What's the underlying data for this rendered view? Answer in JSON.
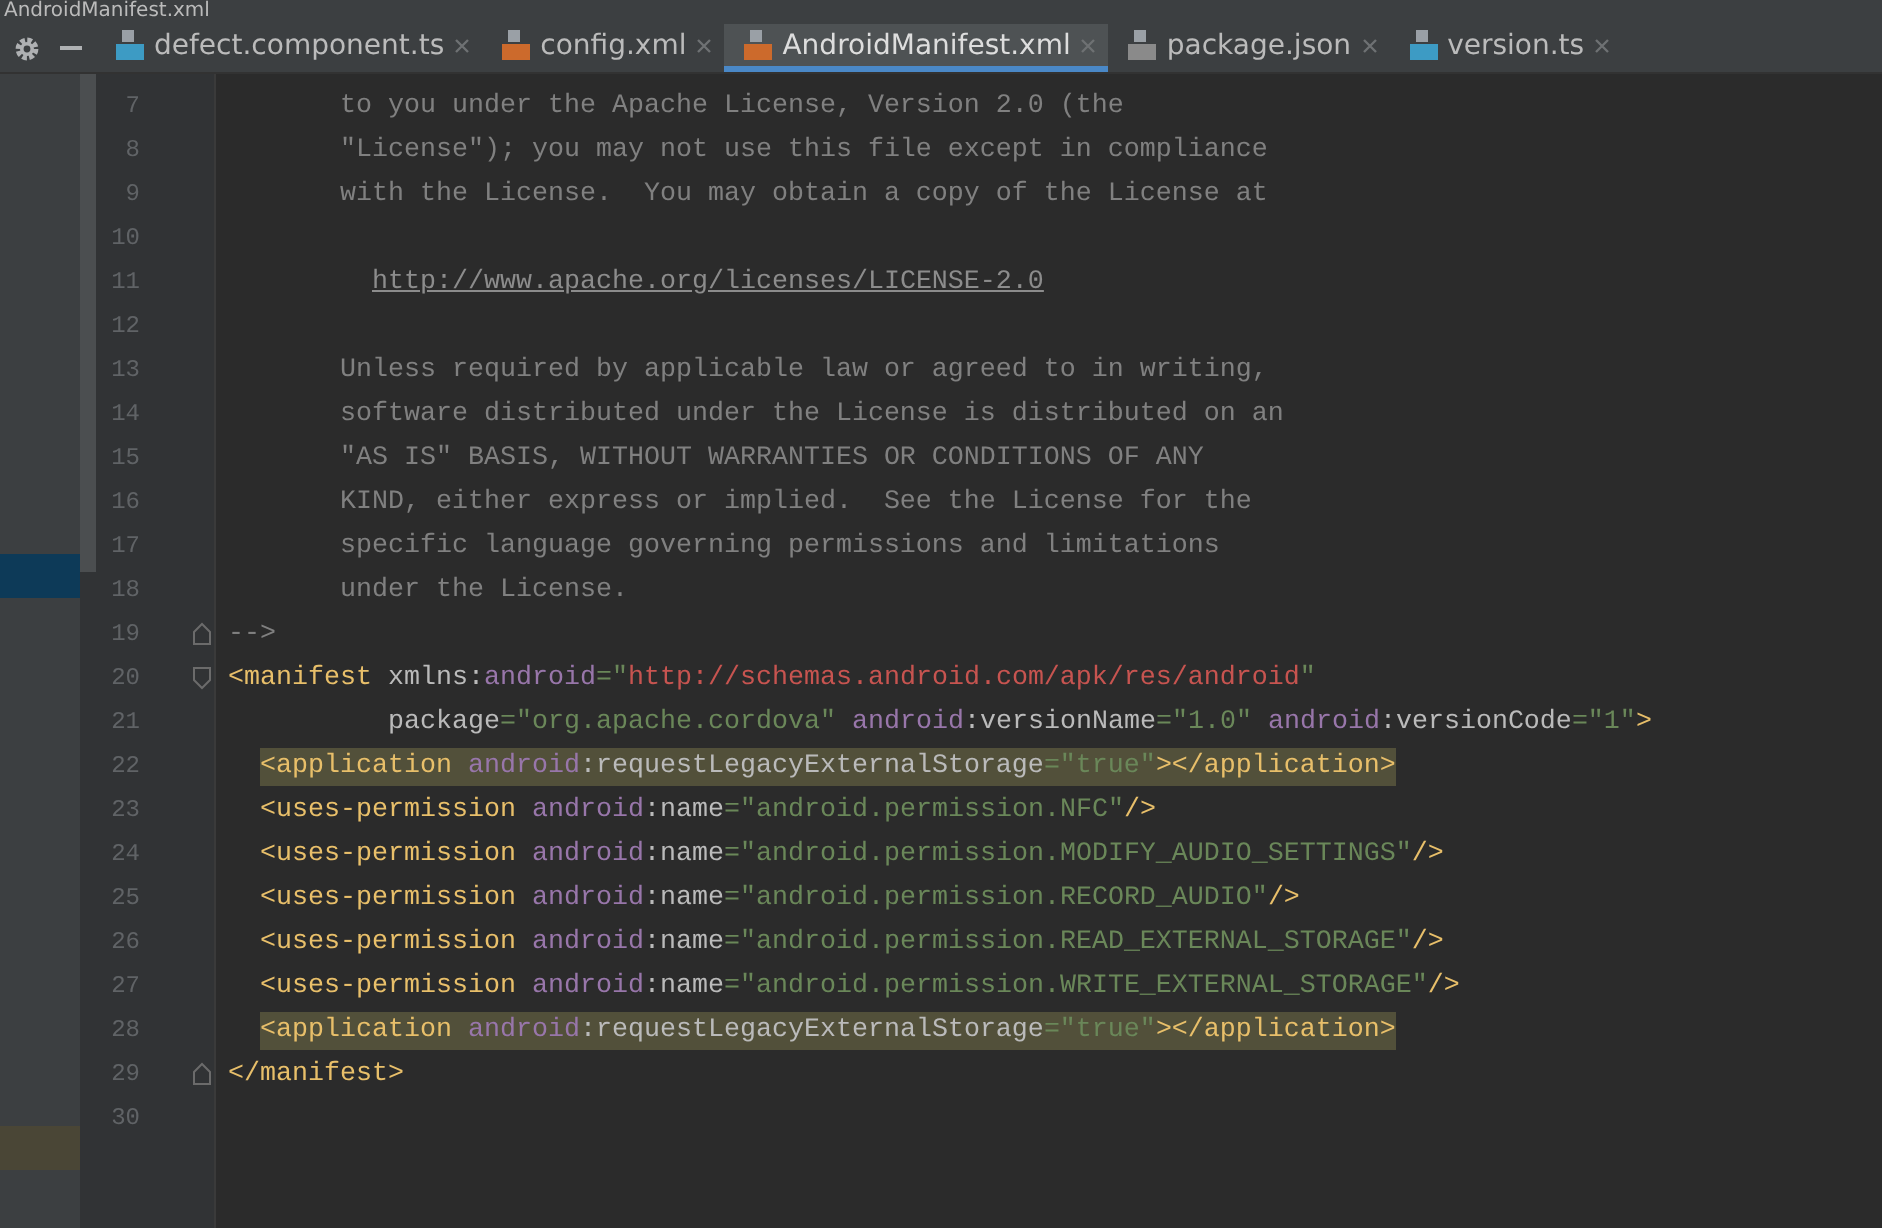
{
  "window": {
    "title": "AndroidManifest.xml"
  },
  "tabs": [
    {
      "label": "defect.component.ts",
      "kind": "ts",
      "selected": false
    },
    {
      "label": "config.xml",
      "kind": "xml",
      "selected": false
    },
    {
      "label": "AndroidManifest.xml",
      "kind": "xml",
      "selected": true
    },
    {
      "label": "package.json",
      "kind": "json",
      "selected": false
    },
    {
      "label": "version.ts",
      "kind": "ts",
      "selected": false
    }
  ],
  "sidebar": {
    "items": [
      {
        "selected": true,
        "kind": "plain"
      },
      {
        "selected": true,
        "kind": "match"
      }
    ]
  },
  "editor": {
    "lines": [
      {
        "number": "7",
        "kind": "comment",
        "highlighted": false,
        "tokens": [
          {
            "kind": "comment",
            "text": "to you under the Apache License, Version 2.0 (the"
          }
        ]
      },
      {
        "number": "8",
        "kind": "comment",
        "highlighted": false,
        "tokens": [
          {
            "kind": "comment",
            "text": "\"License\"); you may not use this file except in compliance"
          }
        ]
      },
      {
        "number": "9",
        "kind": "comment",
        "highlighted": false,
        "tokens": [
          {
            "kind": "comment",
            "text": "with the License.  You may obtain a copy of the License at"
          }
        ]
      },
      {
        "number": "10",
        "kind": "blank"
      },
      {
        "number": "11",
        "kind": "link",
        "highlighted": false,
        "tokens": [
          {
            "kind": "link",
            "text": "http://www.apache.org/licenses/LICENSE-2.0"
          }
        ]
      },
      {
        "number": "12",
        "kind": "blank"
      },
      {
        "number": "13",
        "kind": "comment",
        "highlighted": false,
        "tokens": [
          {
            "kind": "comment",
            "text": "Unless required by applicable law or agreed to in writing,"
          }
        ]
      },
      {
        "number": "14",
        "kind": "comment",
        "highlighted": false,
        "tokens": [
          {
            "kind": "comment",
            "text": "software distributed under the License is distributed on an"
          }
        ]
      },
      {
        "number": "15",
        "kind": "comment",
        "highlighted": false,
        "tokens": [
          {
            "kind": "comment",
            "text": "\"AS IS\" BASIS, WITHOUT WARRANTIES OR CONDITIONS OF ANY"
          }
        ]
      },
      {
        "number": "16",
        "kind": "comment",
        "highlighted": false,
        "tokens": [
          {
            "kind": "comment",
            "text": "KIND, either express or implied.  See the License for the"
          }
        ]
      },
      {
        "number": "17",
        "kind": "comment",
        "highlighted": false,
        "tokens": [
          {
            "kind": "comment",
            "text": "specific language governing permissions and limitations"
          }
        ]
      },
      {
        "number": "18",
        "kind": "comment",
        "highlighted": false,
        "tokens": [
          {
            "kind": "comment",
            "text": "under the License."
          }
        ]
      },
      {
        "number": "19",
        "kind": "fold-end",
        "highlighted": false,
        "tokens": [
          {
            "kind": "comment",
            "text": "-->"
          }
        ]
      },
      {
        "number": "20",
        "kind": "fold-start",
        "highlighted": false,
        "tokens": [
          {
            "kind": "tag",
            "text": "<manifest "
          },
          {
            "kind": "attr",
            "text": "xmlns:"
          },
          {
            "kind": "ns",
            "text": "android"
          },
          {
            "kind": "value",
            "text": "=\""
          },
          {
            "kind": "url",
            "text": "http://schemas.android.com/apk/res/android"
          },
          {
            "kind": "value",
            "text": "\""
          }
        ]
      },
      {
        "number": "21",
        "kind": "continuation",
        "highlighted": false,
        "tokens": [
          {
            "kind": "attr",
            "text": "package"
          },
          {
            "kind": "value",
            "text": "=\"org.apache.cordova\" "
          },
          {
            "kind": "ns",
            "text": "android"
          },
          {
            "kind": "attr",
            "text": ":versionName"
          },
          {
            "kind": "value",
            "text": "=\"1.0\" "
          },
          {
            "kind": "ns",
            "text": "android"
          },
          {
            "kind": "attr",
            "text": ":versionCode"
          },
          {
            "kind": "value",
            "text": "=\"1\""
          },
          {
            "kind": "tag",
            "text": ">"
          }
        ]
      },
      {
        "number": "22",
        "kind": "element",
        "highlighted": true,
        "tokens": [
          {
            "kind": "tag",
            "text": "<application "
          },
          {
            "kind": "ns",
            "text": "android"
          },
          {
            "kind": "attr",
            "text": ":requestLegacyExternalStorage"
          },
          {
            "kind": "value",
            "text": "=\"true\""
          },
          {
            "kind": "tag",
            "text": "></application>"
          }
        ]
      },
      {
        "number": "23",
        "kind": "element",
        "highlighted": false,
        "tokens": [
          {
            "kind": "tag",
            "text": "<uses-permission "
          },
          {
            "kind": "ns",
            "text": "android"
          },
          {
            "kind": "attr",
            "text": ":name"
          },
          {
            "kind": "value",
            "text": "=\"android.permission.NFC\""
          },
          {
            "kind": "tag",
            "text": "/>"
          }
        ]
      },
      {
        "number": "24",
        "kind": "element",
        "highlighted": false,
        "tokens": [
          {
            "kind": "tag",
            "text": "<uses-permission "
          },
          {
            "kind": "ns",
            "text": "android"
          },
          {
            "kind": "attr",
            "text": ":name"
          },
          {
            "kind": "value",
            "text": "=\"android.permission.MODIFY_AUDIO_SETTINGS\""
          },
          {
            "kind": "tag",
            "text": "/>"
          }
        ]
      },
      {
        "number": "25",
        "kind": "element",
        "highlighted": false,
        "tokens": [
          {
            "kind": "tag",
            "text": "<uses-permission "
          },
          {
            "kind": "ns",
            "text": "android"
          },
          {
            "kind": "attr",
            "text": ":name"
          },
          {
            "kind": "value",
            "text": "=\"android.permission.RECORD_AUDIO\""
          },
          {
            "kind": "tag",
            "text": "/>"
          }
        ]
      },
      {
        "number": "26",
        "kind": "element",
        "highlighted": false,
        "tokens": [
          {
            "kind": "tag",
            "text": "<uses-permission "
          },
          {
            "kind": "ns",
            "text": "android"
          },
          {
            "kind": "attr",
            "text": ":name"
          },
          {
            "kind": "value",
            "text": "=\"android.permission.READ_EXTERNAL_STORAGE\""
          },
          {
            "kind": "tag",
            "text": "/>"
          }
        ]
      },
      {
        "number": "27",
        "kind": "element",
        "highlighted": false,
        "tokens": [
          {
            "kind": "tag",
            "text": "<uses-permission "
          },
          {
            "kind": "ns",
            "text": "android"
          },
          {
            "kind": "attr",
            "text": ":name"
          },
          {
            "kind": "value",
            "text": "=\"android.permission.WRITE_EXTERNAL_STORAGE\""
          },
          {
            "kind": "tag",
            "text": "/>"
          }
        ]
      },
      {
        "number": "28",
        "kind": "element",
        "highlighted": true,
        "tokens": [
          {
            "kind": "tag",
            "text": "<application "
          },
          {
            "kind": "ns",
            "text": "android"
          },
          {
            "kind": "attr",
            "text": ":requestLegacyExternalStorage"
          },
          {
            "kind": "value",
            "text": "=\"true\""
          },
          {
            "kind": "tag",
            "text": "></application>"
          }
        ]
      },
      {
        "number": "29",
        "kind": "fold-end",
        "highlighted": false,
        "tokens": [
          {
            "kind": "tag",
            "text": "</manifest>"
          }
        ]
      },
      {
        "number": "30",
        "kind": "blank"
      }
    ]
  }
}
